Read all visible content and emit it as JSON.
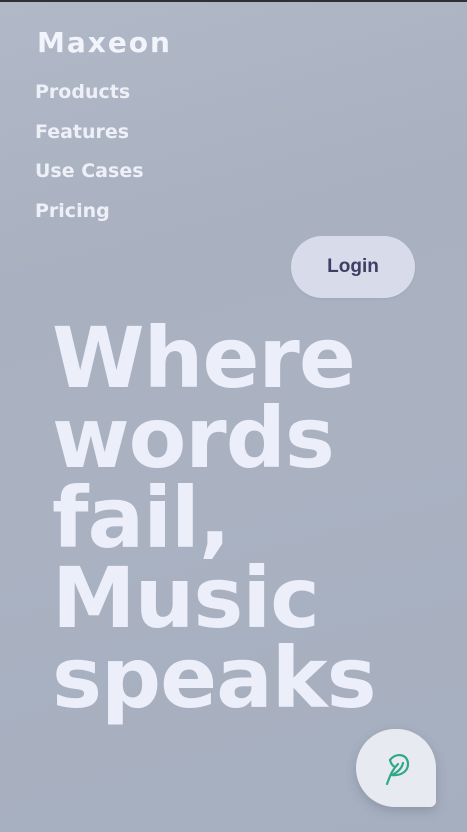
{
  "brand": {
    "name": "Maxeon"
  },
  "nav": {
    "items": [
      {
        "label": "Products"
      },
      {
        "label": "Features"
      },
      {
        "label": "Use Cases"
      },
      {
        "label": "Pricing"
      }
    ]
  },
  "header": {
    "login_label": "Login"
  },
  "hero": {
    "lines": [
      "Where",
      "words",
      "fail,",
      "Music",
      "speaks"
    ]
  },
  "fab": {
    "icon": "feather-chat-icon",
    "accent": "#2fa88a"
  },
  "colors": {
    "background": "#aab2c2",
    "text_light": "#eceff9",
    "login_text": "#3e3e66",
    "login_bg": "#d8dcea"
  }
}
